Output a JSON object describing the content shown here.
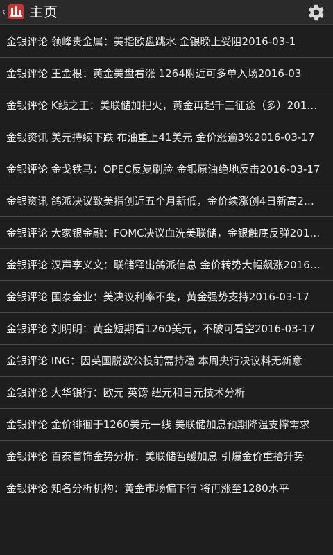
{
  "header": {
    "title": "主页",
    "back_glyph": "《",
    "app_icon": "app-logo-icon",
    "settings_icon": "gear-icon"
  },
  "colors": {
    "background": "#1e1e1e",
    "actionbar": "#2a2a2a",
    "divider": "#4a4a4a",
    "text": "#ececec",
    "logo_red": "#d32f2f"
  },
  "articles": [
    {
      "title": "金银评论 领峰贵金属：美指欧盘跳水 金银晚上受阻2016-03-1"
    },
    {
      "title": "金银评论 王金根：黄金美盘看涨 1264附近可多单入场2016-03"
    },
    {
      "title": "金银评论 K线之王：美联储加把火，黄金再起千三征途（多）201…"
    },
    {
      "title": "金银资讯 美元持续下跌 布油重上41美元 金价涨逾3%2016-03-17"
    },
    {
      "title": "金银评论 金戈铁马：OPEC反复刷脸 金银原油绝地反击2016-03-17"
    },
    {
      "title": "金银资讯 鸽派决议致美指创近五个月新低，金价续涨创4日新高2…"
    },
    {
      "title": "金银评论 大家银金融：FOMC决议血洗美联储，金银触底反弹201…"
    },
    {
      "title": "金银评论 汉声李义文：联储释出鸽派信息 金价转势大幅飙涨2016…"
    },
    {
      "title": "金银评论 国泰金业：美决议利率不变，黄金强势支持2016-03-17"
    },
    {
      "title": "金银评论 刘明明：黄金短期看1260美元，不破可看空2016-03-17"
    },
    {
      "title": "金银评论 ING：因英国脱欧公投前需持稳 本周央行决议料无新意"
    },
    {
      "title": "金银评论 大华银行：欧元 英镑 纽元和日元技术分析"
    },
    {
      "title": "金银评论 金价徘徊于1260美元一线 美联储加息预期降温支撑需求"
    },
    {
      "title": "金银评论 百泰首饰金势分析：美联储暂缓加息 引爆金价重拾升势"
    },
    {
      "title": "金银评论 知名分析机构：黄金市场偏下行 将再涨至1280水平"
    }
  ]
}
